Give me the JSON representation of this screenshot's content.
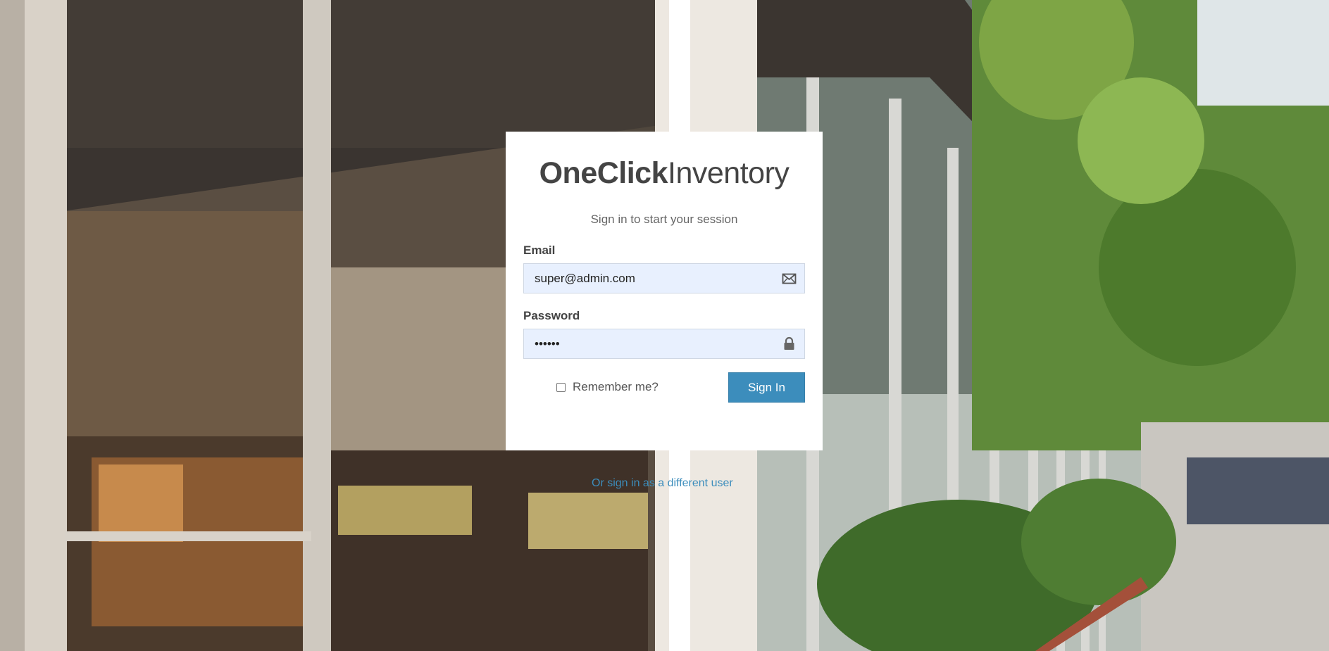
{
  "logo": {
    "bold": "OneClick",
    "light": "Inventory"
  },
  "login": {
    "message": "Sign in to start your session",
    "email_label": "Email",
    "email_value": "super@admin.com",
    "email_icon": "envelope-icon",
    "password_label": "Password",
    "password_value": "••••••",
    "password_icon": "lock-icon",
    "remember_label": "Remember me?",
    "remember_checked": false,
    "signin_label": "Sign In",
    "different_user_link": "Or sign in as a different user"
  },
  "colors": {
    "accent": "#3c8dbc",
    "input_bg": "#e8f0fe"
  }
}
